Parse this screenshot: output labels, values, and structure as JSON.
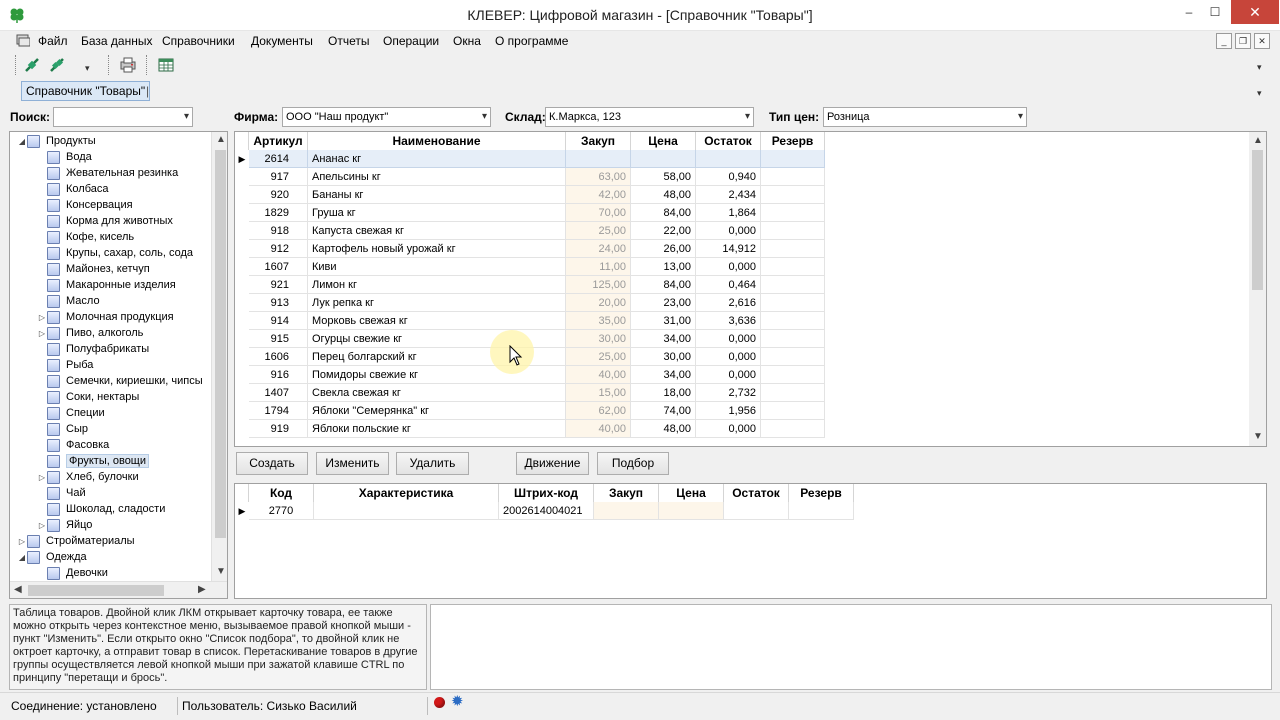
{
  "window": {
    "title": "КЛЕВЕР: Цифровой магазин - [Справочник \"Товары\"]",
    "controls": {
      "minimize": "–",
      "maximize": "☐",
      "close": "✕"
    }
  },
  "menu": [
    "Файл",
    "База данных",
    "Справочники",
    "Документы",
    "Отчеты",
    "Операции",
    "Окна",
    "О программе"
  ],
  "mdi_controls": {
    "minimize": "_",
    "restore": "❐",
    "close": "✕"
  },
  "toolbar": {
    "icons": [
      "connect-icon",
      "disconnect-icon",
      "dropdown-chevron-icon",
      "print-icon",
      "table-icon"
    ]
  },
  "document_tab": "Справочник \"Товары\"",
  "filters": {
    "search_label": "Поиск:",
    "search_value": "",
    "firm_label": "Фирма:",
    "firm_value": "ООО \"Наш продукт\"",
    "warehouse_label": "Склад:",
    "warehouse_value": "К.Маркса, 123",
    "price_type_label": "Тип цен:",
    "price_type_value": "Розница"
  },
  "tree": [
    {
      "label": "Продукты",
      "level": 0,
      "expander": "◢",
      "open": true
    },
    {
      "label": "Вода",
      "level": 1
    },
    {
      "label": "Жевательная резинка",
      "level": 1
    },
    {
      "label": "Колбаса",
      "level": 1
    },
    {
      "label": "Консервация",
      "level": 1
    },
    {
      "label": "Корма для животных",
      "level": 1
    },
    {
      "label": "Кофе, кисель",
      "level": 1
    },
    {
      "label": "Крупы, сахар, соль, сода",
      "level": 1
    },
    {
      "label": "Майонез, кетчуп",
      "level": 1
    },
    {
      "label": "Макаронные изделия",
      "level": 1
    },
    {
      "label": "Масло",
      "level": 1
    },
    {
      "label": "Молочная продукция",
      "level": 1,
      "expander": "▷"
    },
    {
      "label": "Пиво, алкоголь",
      "level": 1,
      "expander": "▷"
    },
    {
      "label": "Полуфабрикаты",
      "level": 1
    },
    {
      "label": "Рыба",
      "level": 1
    },
    {
      "label": "Семечки, кириешки, чипсы",
      "level": 1
    },
    {
      "label": "Соки, нектары",
      "level": 1
    },
    {
      "label": "Специи",
      "level": 1
    },
    {
      "label": "Сыр",
      "level": 1
    },
    {
      "label": "Фасовка",
      "level": 1
    },
    {
      "label": "Фрукты, овощи",
      "level": 1,
      "selected": true
    },
    {
      "label": "Хлеб, булочки",
      "level": 1,
      "expander": "▷"
    },
    {
      "label": "Чай",
      "level": 1
    },
    {
      "label": "Шоколад, сладости",
      "level": 1
    },
    {
      "label": "Яйцо",
      "level": 1,
      "expander": "▷"
    },
    {
      "label": "Стройматериалы",
      "level": 0,
      "expander": "▷"
    },
    {
      "label": "Одежда",
      "level": 0,
      "expander": "◢",
      "open": true
    },
    {
      "label": "Девочки",
      "level": 1
    }
  ],
  "products": {
    "columns": [
      "Артикул",
      "Наименование",
      "Закуп",
      "Цена",
      "Остаток",
      "Резерв"
    ],
    "current_marker": "▶",
    "rows": [
      [
        "2614",
        "Ананас кг",
        "",
        "",
        "",
        ""
      ],
      [
        "917",
        "Апельсины кг",
        "63,00",
        "58,00",
        "0,940",
        ""
      ],
      [
        "920",
        "Бананы кг",
        "42,00",
        "48,00",
        "2,434",
        ""
      ],
      [
        "1829",
        "Груша кг",
        "70,00",
        "84,00",
        "1,864",
        ""
      ],
      [
        "918",
        "Капуста свежая кг",
        "25,00",
        "22,00",
        "0,000",
        ""
      ],
      [
        "912",
        "Картофель новый урожай кг",
        "24,00",
        "26,00",
        "14,912",
        ""
      ],
      [
        "1607",
        "Киви",
        "11,00",
        "13,00",
        "0,000",
        ""
      ],
      [
        "921",
        "Лимон кг",
        "125,00",
        "84,00",
        "0,464",
        ""
      ],
      [
        "913",
        "Лук репка кг",
        "20,00",
        "23,00",
        "2,616",
        ""
      ],
      [
        "914",
        "Морковь свежая кг",
        "35,00",
        "31,00",
        "3,636",
        ""
      ],
      [
        "915",
        "Огурцы свежие кг",
        "30,00",
        "34,00",
        "0,000",
        ""
      ],
      [
        "1606",
        "Перец болгарский кг",
        "25,00",
        "30,00",
        "0,000",
        ""
      ],
      [
        "916",
        "Помидоры свежие кг",
        "40,00",
        "34,00",
        "0,000",
        ""
      ],
      [
        "1407",
        "Свекла свежая кг",
        "15,00",
        "18,00",
        "2,732",
        ""
      ],
      [
        "1794",
        "Яблоки \"Семерянка\" кг",
        "62,00",
        "74,00",
        "1,956",
        ""
      ],
      [
        "919",
        "Яблоки польские кг",
        "40,00",
        "48,00",
        "0,000",
        ""
      ]
    ]
  },
  "actions": [
    "Создать",
    "Изменить",
    "Удалить",
    "Движение",
    "Подбор"
  ],
  "characteristics": {
    "columns": [
      "Код",
      "Характеристика",
      "Штрих-код",
      "Закуп",
      "Цена",
      "Остаток",
      "Резерв"
    ],
    "rows": [
      [
        "2770",
        "",
        "2002614004021",
        "",
        "",
        "",
        ""
      ]
    ]
  },
  "help_text": "Таблица товаров. Двойной клик ЛКМ открывает карточку товара, ее также можно открыть через контекстное меню, вызываемое правой кнопкой мыши - пункт \"Изменить\". Если открыто окно \"Список подбора\", то двойной клик не октроет карточку, а отправит товар в список. Перетаскивание товаров в другие группы осуществляется левой кнопкой мыши при зажатой клавише CTRL по принципу \"перетащи и брось\".",
  "status": {
    "connection": "Соединение: установлено",
    "user": "Пользователь: Сизько Василий"
  },
  "colors": {
    "accent": "#3a79c4",
    "close_button": "#c7453a",
    "cost_column_bg": "#fdf6ea",
    "status_dot": "#d21818"
  }
}
